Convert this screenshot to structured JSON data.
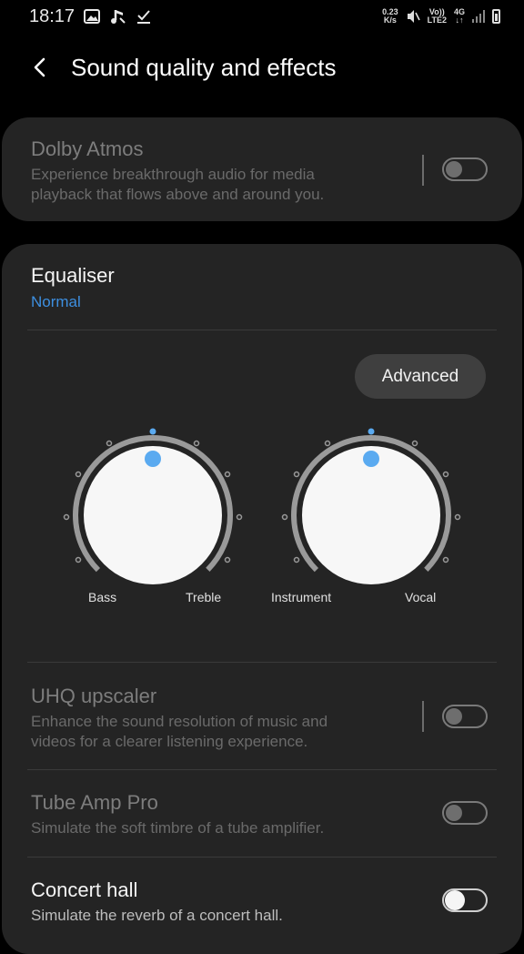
{
  "status_bar": {
    "time": "18:17",
    "net_speed": "0.23",
    "net_unit": "K/s",
    "volte": "Vo))",
    "lte": "LTE2",
    "gen": "4G"
  },
  "header": {
    "title": "Sound quality and effects",
    "back_icon": "chevron-left-icon"
  },
  "dolby": {
    "title": "Dolby Atmos",
    "subtitle_line1": "Experience breakthrough audio for media",
    "subtitle_line2": "playback that flows above and around you.",
    "enabled": false
  },
  "equaliser": {
    "title": "Equaliser",
    "value": "Normal",
    "advanced_label": "Advanced",
    "knobs": [
      {
        "left_label": "Bass",
        "right_label": "Treble"
      },
      {
        "left_label": "Instrument",
        "right_label": "Vocal"
      }
    ]
  },
  "uhq": {
    "title": "UHQ upscaler",
    "subtitle_line1": "Enhance the sound resolution of music and",
    "subtitle_line2": "videos for a clearer listening experience.",
    "enabled": false
  },
  "tube": {
    "title": "Tube Amp Pro",
    "subtitle": "Simulate the soft timbre of a tube amplifier.",
    "enabled": false
  },
  "concert": {
    "title": "Concert hall",
    "subtitle": "Simulate the reverb of a concert hall.",
    "enabled": false
  },
  "colors": {
    "accent": "#3d8fe0",
    "knob_dot": "#5aaaf0"
  }
}
